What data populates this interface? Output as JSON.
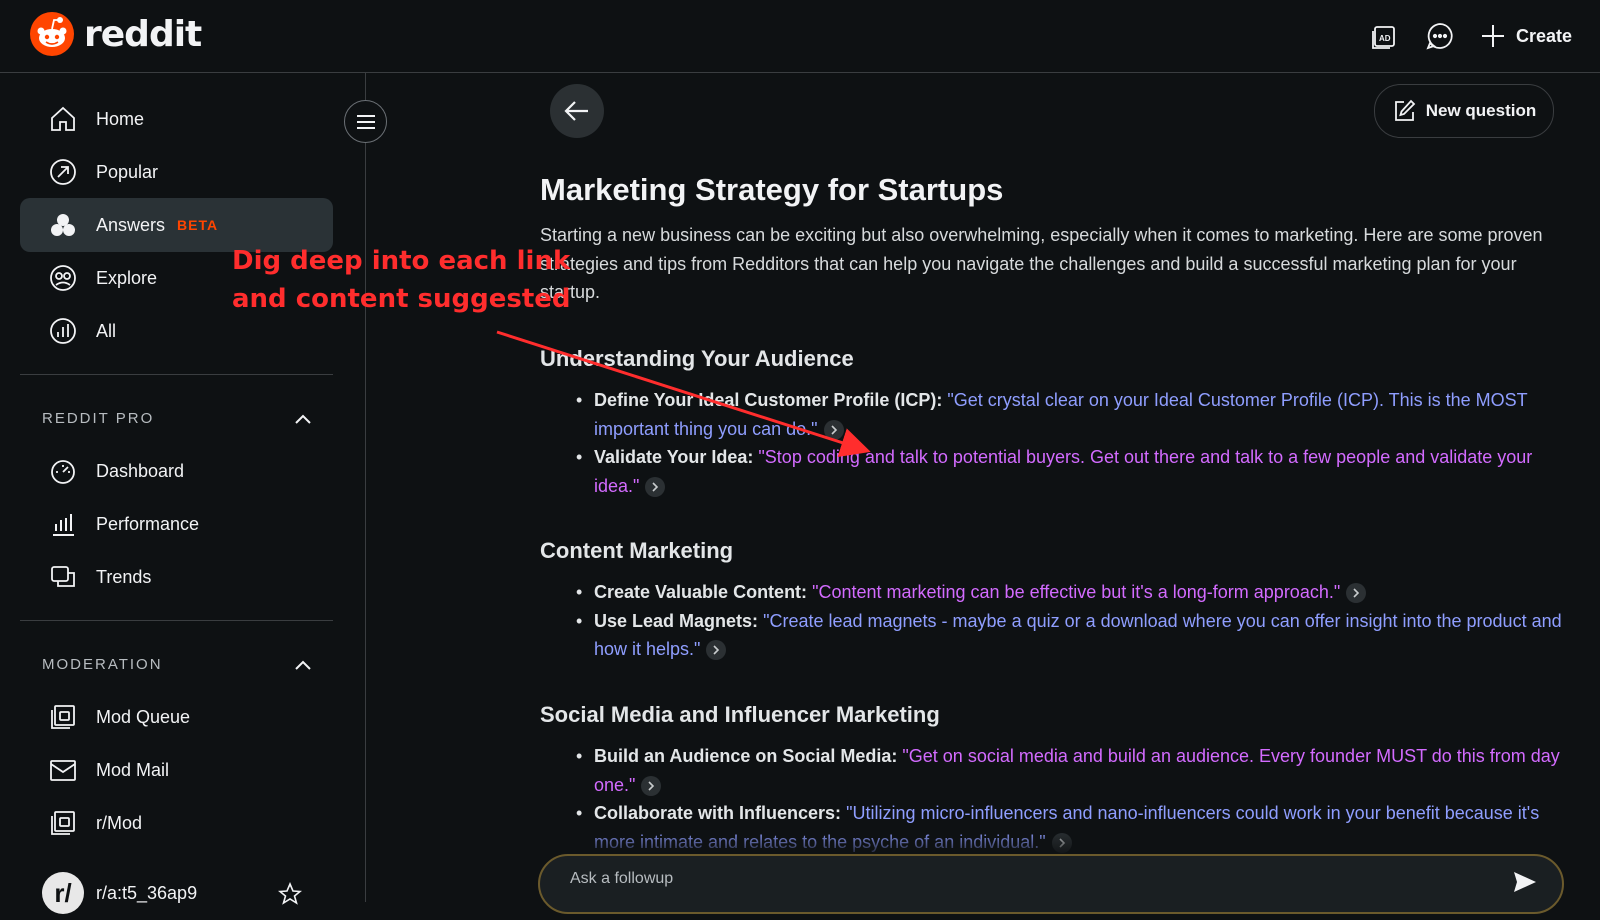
{
  "header": {
    "logo_text": "reddit",
    "create_label": "Create",
    "icons": [
      "ad-icon",
      "chat-icon",
      "plus-icon"
    ]
  },
  "sidebar": {
    "items": [
      {
        "label": "Home",
        "icon": "home-icon"
      },
      {
        "label": "Popular",
        "icon": "popular-icon"
      },
      {
        "label": "Answers",
        "icon": "answers-icon",
        "badge": "BETA",
        "active": true
      },
      {
        "label": "Explore",
        "icon": "explore-icon"
      },
      {
        "label": "All",
        "icon": "all-icon"
      }
    ],
    "reddit_pro": {
      "heading": "REDDIT PRO",
      "items": [
        {
          "label": "Dashboard",
          "icon": "dashboard-icon"
        },
        {
          "label": "Performance",
          "icon": "performance-icon"
        },
        {
          "label": "Trends",
          "icon": "trends-icon"
        }
      ]
    },
    "moderation": {
      "heading": "MODERATION",
      "items": [
        {
          "label": "Mod Queue",
          "icon": "mod-queue-icon"
        },
        {
          "label": "Mod Mail",
          "icon": "mod-mail-icon"
        },
        {
          "label": "r/Mod",
          "icon": "r-mod-icon"
        },
        {
          "label": "r/a:t5_36ap9",
          "icon": "community-avatar"
        }
      ]
    }
  },
  "annotation": {
    "line1": "Dig deep into each link",
    "line2": "and content suggested",
    "color": "#ff2d2d"
  },
  "main": {
    "new_question_label": "New question",
    "title": "Marketing Strategy for Startups",
    "intro": "Starting a new business can be exciting but also overwhelming, especially when it comes to marketing. Here are some proven strategies and tips from Redditors that can help you navigate the challenges and build a successful marketing plan for your startup.",
    "sections": [
      {
        "heading": "Understanding Your Audience",
        "bullets": [
          {
            "label": "Define Your Ideal Customer Profile (ICP):",
            "quote": "\"Get crystal clear on your Ideal Customer Profile (ICP). This is the MOST important thing you can do.\""
          },
          {
            "label": "Validate Your Idea:",
            "quote": "\"Stop coding and talk to potential buyers. Get out there and talk to a few people and validate your idea.\""
          }
        ]
      },
      {
        "heading": "Content Marketing",
        "bullets": [
          {
            "label": "Create Valuable Content:",
            "quote": "\"Content marketing can be effective but it's a long-form approach.\""
          },
          {
            "label": "Use Lead Magnets:",
            "quote": "\"Create lead magnets - maybe a quiz or a download where you can offer insight into the product and how it helps.\""
          }
        ]
      },
      {
        "heading": "Social Media and Influencer Marketing",
        "bullets": [
          {
            "label": "Build an Audience on Social Media:",
            "quote": "\"Get on social media and build an audience. Every founder MUST do this from day one.\""
          },
          {
            "label": "Collaborate with Influencers:",
            "quote": "\"Utilizing micro-influencers and nano-influencers could work in your benefit because it's more intimate and relates to the psyche of an individual.\""
          }
        ]
      }
    ],
    "followup_placeholder": "Ask a followup"
  },
  "colors": {
    "background": "#0e1113",
    "brand": "#ff4500",
    "quote_blue": "#8f9eff",
    "quote_purple": "#d36bff"
  }
}
